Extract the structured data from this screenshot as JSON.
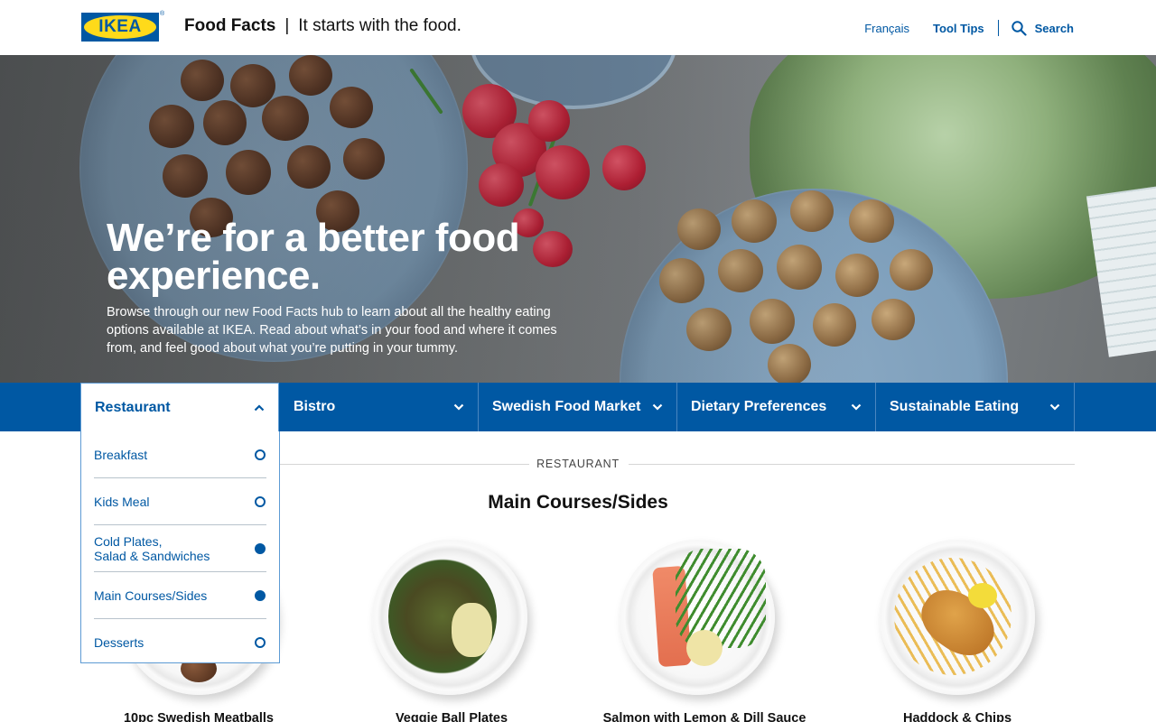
{
  "header": {
    "logo_text": "IKEA",
    "logo_reg": "®",
    "brand_bold": "Food Facts",
    "brand_separator": "|",
    "brand_tagline": "It starts with the food.",
    "nav": {
      "language": "Français",
      "tool_tips": "Tool Tips",
      "search": "Search"
    }
  },
  "hero": {
    "title": "We’re for a better food experience.",
    "body": "Browse through our new Food Facts hub to learn about all the healthy eating options available at IKEA. Read about what’s in your food and where it comes from, and feel good about what you’re putting in your tummy."
  },
  "categories": [
    {
      "label": "Restaurant",
      "expanded": true
    },
    {
      "label": "Bistro",
      "expanded": false
    },
    {
      "label": "Swedish Food Market",
      "expanded": false
    },
    {
      "label": "Dietary Preferences",
      "expanded": false
    },
    {
      "label": "Sustainable Eating",
      "expanded": false
    }
  ],
  "restaurant_menu": [
    {
      "label": "Breakfast",
      "selected": false
    },
    {
      "label": "Kids Meal",
      "selected": false
    },
    {
      "label": "Cold Plates,",
      "label2": "Salad & Sandwiches",
      "selected": true
    },
    {
      "label": "Main Courses/Sides",
      "selected": true
    },
    {
      "label": "Desserts",
      "selected": false
    }
  ],
  "section": {
    "label": "RESTAURANT",
    "title": "Main Courses/Sides"
  },
  "dishes": [
    {
      "name": "10pc Swedish Meatballs"
    },
    {
      "name": "Veggie Ball Plates"
    },
    {
      "name": "Salmon with Lemon & Dill Sauce"
    },
    {
      "name": "Haddock & Chips"
    }
  ],
  "colors": {
    "ikea_blue": "#0058A3",
    "ikea_yellow": "#FFDA1A"
  }
}
